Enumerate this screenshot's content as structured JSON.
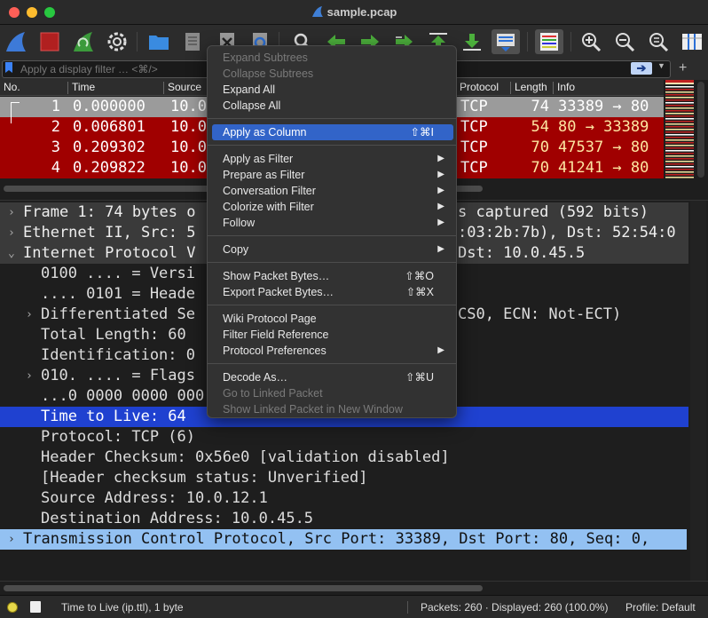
{
  "window": {
    "title": "sample.pcap"
  },
  "filter": {
    "placeholder": "Apply a display filter … <⌘/>",
    "apply_arrow": "➔"
  },
  "packet_list": {
    "columns": [
      "No.",
      "Time",
      "Source",
      "Protocol",
      "Length",
      "Info"
    ],
    "rows": [
      {
        "no": "1",
        "time": "0.000000",
        "src": "10.0",
        "proto": "TCP",
        "len": "74",
        "info": "33389 → 80",
        "bg": "#9b9b9b",
        "fg": "#ffffff"
      },
      {
        "no": "2",
        "time": "0.006801",
        "src": "10.0",
        "proto": "TCP",
        "len": "54",
        "info": "80 → 33389",
        "bg": "#a00000",
        "fg": "#fde6a2"
      },
      {
        "no": "3",
        "time": "0.209302",
        "src": "10.0",
        "proto": "TCP",
        "len": "70",
        "info": "47537 → 80",
        "bg": "#a00000",
        "fg": "#fde6a2"
      },
      {
        "no": "4",
        "time": "0.209822",
        "src": "10.0",
        "proto": "TCP",
        "len": "70",
        "info": "41241 → 80",
        "bg": "#a00000",
        "fg": "#fde6a2"
      }
    ]
  },
  "details": {
    "rows": [
      {
        "text": "Frame 1: 74 bytes o",
        "tail": "s captured (592 bits)",
        "indent": 0,
        "expander": ">",
        "style": "section"
      },
      {
        "text": "Ethernet II, Src: 5",
        "tail": ":03:2b:7b), Dst: 52:54:0",
        "indent": 0,
        "expander": ">",
        "style": "section"
      },
      {
        "text": "Internet Protocol V",
        "tail": "Dst: 10.0.45.5",
        "indent": 0,
        "expander": "v",
        "style": "section"
      },
      {
        "text": "0100 .... = Versi",
        "tail": "",
        "indent": 1,
        "expander": "",
        "style": "normal"
      },
      {
        "text": ".... 0101 = Heade",
        "tail": "",
        "indent": 1,
        "expander": "",
        "style": "normal"
      },
      {
        "text": "Differentiated Se",
        "tail": "CS0, ECN: Not-ECT)",
        "indent": 1,
        "expander": ">",
        "style": "normal"
      },
      {
        "text": "Total Length: 60",
        "tail": "",
        "indent": 1,
        "expander": "",
        "style": "normal"
      },
      {
        "text": "Identification: 0",
        "tail": "",
        "indent": 1,
        "expander": "",
        "style": "normal"
      },
      {
        "text": "010. .... = Flags",
        "tail": "",
        "indent": 1,
        "expander": ">",
        "style": "normal"
      },
      {
        "text": "...0 0000 0000 000",
        "tail": "",
        "indent": 1,
        "expander": "",
        "style": "normal"
      },
      {
        "text": "Time to Live: 64",
        "tail": "",
        "indent": 1,
        "expander": "",
        "style": "selected"
      },
      {
        "text": "Protocol: TCP (6)",
        "tail": "",
        "indent": 1,
        "expander": "",
        "style": "normal"
      },
      {
        "text": "Header Checksum: 0x56e0 [validation disabled]",
        "tail": "",
        "indent": 1,
        "expander": "",
        "style": "normal"
      },
      {
        "text": "[Header checksum status: Unverified]",
        "tail": "",
        "indent": 1,
        "expander": "",
        "style": "normal"
      },
      {
        "text": "Source Address: 10.0.12.1",
        "tail": "",
        "indent": 1,
        "expander": "",
        "style": "normal"
      },
      {
        "text": "Destination Address: 10.0.45.5",
        "tail": "",
        "indent": 1,
        "expander": "",
        "style": "normal"
      },
      {
        "text": "Transmission Control Protocol, Src Port: 33389, Dst Port: 80, Seq: 0,",
        "tail": "",
        "indent": 0,
        "expander": ">",
        "style": "tcp"
      }
    ]
  },
  "context_menu": {
    "items": [
      {
        "label": "Expand Subtrees",
        "shortcut": "",
        "submenu": false,
        "disabled": true,
        "highlighted": false
      },
      {
        "label": "Collapse Subtrees",
        "shortcut": "",
        "submenu": false,
        "disabled": true,
        "highlighted": false
      },
      {
        "label": "Expand All",
        "shortcut": "",
        "submenu": false,
        "disabled": false,
        "highlighted": false
      },
      {
        "label": "Collapse All",
        "shortcut": "",
        "submenu": false,
        "disabled": false,
        "highlighted": false
      },
      {
        "sep": true
      },
      {
        "label": "Apply as Column",
        "shortcut": "⇧⌘I",
        "submenu": false,
        "disabled": false,
        "highlighted": true
      },
      {
        "sep": true
      },
      {
        "label": "Apply as Filter",
        "shortcut": "",
        "submenu": true,
        "disabled": false,
        "highlighted": false
      },
      {
        "label": "Prepare as Filter",
        "shortcut": "",
        "submenu": true,
        "disabled": false,
        "highlighted": false
      },
      {
        "label": "Conversation Filter",
        "shortcut": "",
        "submenu": true,
        "disabled": false,
        "highlighted": false
      },
      {
        "label": "Colorize with Filter",
        "shortcut": "",
        "submenu": true,
        "disabled": false,
        "highlighted": false
      },
      {
        "label": "Follow",
        "shortcut": "",
        "submenu": true,
        "disabled": false,
        "highlighted": false
      },
      {
        "sep": true
      },
      {
        "label": "Copy",
        "shortcut": "",
        "submenu": true,
        "disabled": false,
        "highlighted": false
      },
      {
        "sep": true
      },
      {
        "label": "Show Packet Bytes…",
        "shortcut": "⇧⌘O",
        "submenu": false,
        "disabled": false,
        "highlighted": false
      },
      {
        "label": "Export Packet Bytes…",
        "shortcut": "⇧⌘X",
        "submenu": false,
        "disabled": false,
        "highlighted": false
      },
      {
        "sep": true
      },
      {
        "label": "Wiki Protocol Page",
        "shortcut": "",
        "submenu": false,
        "disabled": false,
        "highlighted": false
      },
      {
        "label": "Filter Field Reference",
        "shortcut": "",
        "submenu": false,
        "disabled": false,
        "highlighted": false
      },
      {
        "label": "Protocol Preferences",
        "shortcut": "",
        "submenu": true,
        "disabled": false,
        "highlighted": false
      },
      {
        "sep": true
      },
      {
        "label": "Decode As…",
        "shortcut": "⇧⌘U",
        "submenu": false,
        "disabled": false,
        "highlighted": false
      },
      {
        "label": "Go to Linked Packet",
        "shortcut": "",
        "submenu": false,
        "disabled": true,
        "highlighted": false
      },
      {
        "label": "Show Linked Packet in New Window",
        "shortcut": "",
        "submenu": false,
        "disabled": true,
        "highlighted": false
      }
    ]
  },
  "status": {
    "field": "Time to Live (ip.ttl), 1 byte",
    "packets": "Packets: 260 · Displayed: 260 (100.0%)",
    "profile": "Profile: Default"
  },
  "colors": {
    "selected": "#1f41d0",
    "tcp_section": "#93c1f2",
    "menu_highlight": "#3264c8"
  }
}
